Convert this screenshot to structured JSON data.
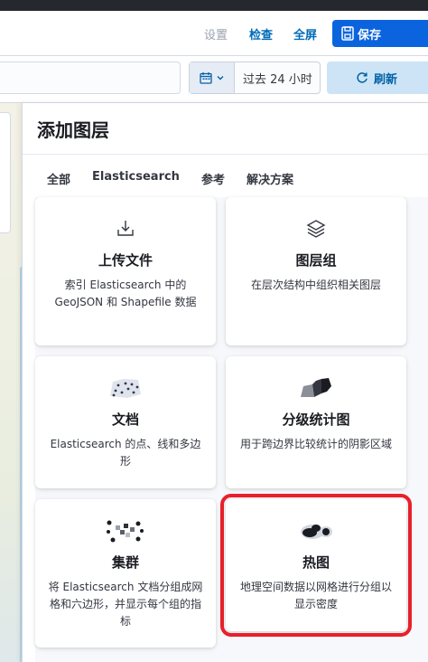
{
  "header": {
    "settings_label": "设置",
    "inspect_label": "检查",
    "fullscreen_label": "全屏",
    "save_label": "保存"
  },
  "query": {
    "time_range": "过去 24 小时",
    "refresh_label": "刷新"
  },
  "panel": {
    "title": "添加图层",
    "tabs": [
      "全部",
      "Elasticsearch",
      "参考",
      "解决方案"
    ],
    "cards": [
      {
        "icon": "import-icon",
        "title": "上传文件",
        "desc": "索引 Elasticsearch 中的 GeoJSON 和 Shapefile 数据"
      },
      {
        "icon": "layers-icon",
        "title": "图层组",
        "desc": "在层次结构中组织相关图层"
      },
      {
        "icon": "documents-map-icon",
        "title": "文档",
        "desc": "Elasticsearch 的点、线和多边形"
      },
      {
        "icon": "choropleth-map-icon",
        "title": "分级统计图",
        "desc": "用于跨边界比较统计的阴影区域"
      },
      {
        "icon": "clusters-map-icon",
        "title": "集群",
        "desc": "将 Elasticsearch 文档分组成网格和六边形，并显示每个组的指标"
      },
      {
        "icon": "heatmap-icon",
        "title": "热图",
        "desc": "地理空间数据以网格进行分组以显示密度"
      }
    ]
  },
  "colors": {
    "primary": "#0b64dd",
    "link": "#006bb8",
    "highlight": "#e8202a"
  }
}
